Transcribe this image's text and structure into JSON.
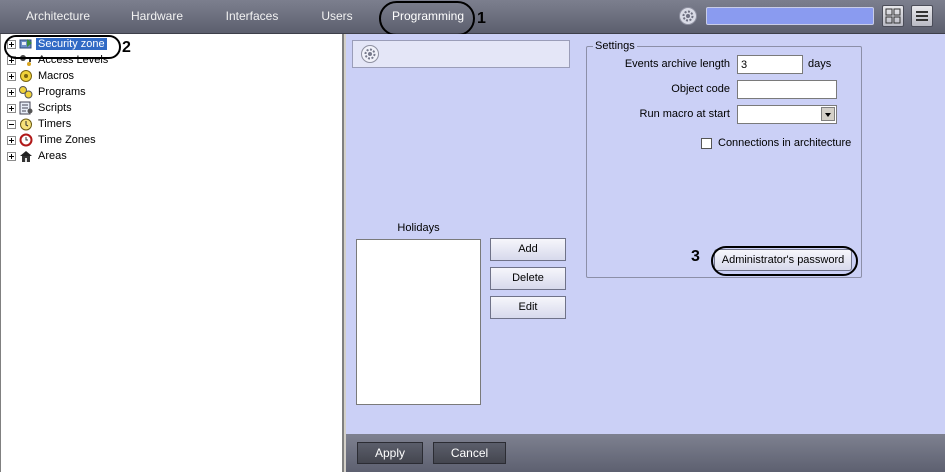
{
  "toolbar": {
    "tabs": [
      {
        "label": "Architecture"
      },
      {
        "label": "Hardware"
      },
      {
        "label": "Interfaces"
      },
      {
        "label": "Users"
      },
      {
        "label": "Programming"
      }
    ],
    "search_value": "",
    "icons": [
      "gear-icon",
      "layout-grid-icon",
      "menu-icon"
    ]
  },
  "callouts": [
    "1",
    "2",
    "3"
  ],
  "tree": {
    "items": [
      {
        "label": "Security zone",
        "icon": "security-zone-icon"
      },
      {
        "label": "Access Levels",
        "icon": "access-levels-icon"
      },
      {
        "label": "Macros",
        "icon": "macros-icon"
      },
      {
        "label": "Programs",
        "icon": "programs-icon"
      },
      {
        "label": "Scripts",
        "icon": "scripts-icon"
      },
      {
        "label": "Timers",
        "icon": "timers-icon"
      },
      {
        "label": "Time Zones",
        "icon": "time-zones-icon"
      },
      {
        "label": "Areas",
        "icon": "areas-icon"
      }
    ]
  },
  "settings": {
    "legend": "Settings",
    "events_archive_label": "Events archive length",
    "events_archive_value": "3",
    "days_label": "days",
    "object_code_label": "Object code",
    "object_code_value": "",
    "run_macro_label": "Run macro at start",
    "run_macro_value": "",
    "connections_label": "Connections in architecture",
    "connections_checked": false,
    "admin_password_button": "Administrator's password"
  },
  "holidays": {
    "title": "Holidays",
    "add_button": "Add",
    "delete_button": "Delete",
    "edit_button": "Edit"
  },
  "footer": {
    "apply_button": "Apply",
    "cancel_button": "Cancel"
  },
  "colors": {
    "toolbar": "#6b6e7d",
    "panel": "#cbd0f6",
    "selection": "#316ac5",
    "search": "#8a9bf0"
  }
}
